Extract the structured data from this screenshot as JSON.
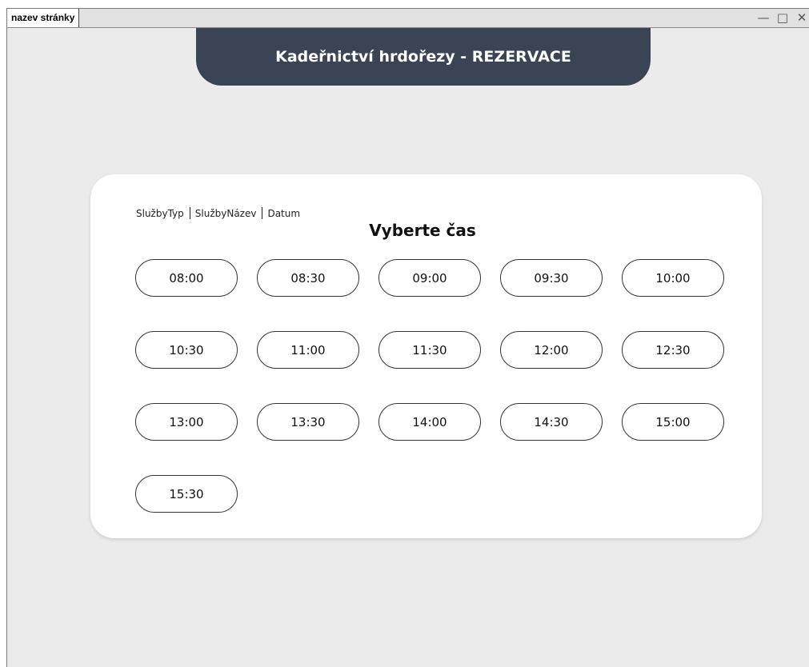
{
  "window": {
    "tab_title": "nazev stránky",
    "controls": {
      "minimize": "—",
      "maximize": "□",
      "close": "✕"
    }
  },
  "header": {
    "title": "Kadeřnictví hrdořezy - REZERVACE"
  },
  "card": {
    "breadcrumbs": [
      "SlužbyTyp",
      "SlužbyNázev",
      "Datum"
    ],
    "title": "Vyberte čas",
    "slots": [
      "08:00",
      "08:30",
      "09:00",
      "09:30",
      "10:00",
      "10:30",
      "11:00",
      "11:30",
      "12:00",
      "12:30",
      "13:00",
      "13:30",
      "14:00",
      "14:30",
      "15:00",
      "15:30"
    ]
  },
  "colors": {
    "header_bg": "#3a4454",
    "page_bg": "#ebebeb",
    "card_bg": "#ffffff"
  }
}
